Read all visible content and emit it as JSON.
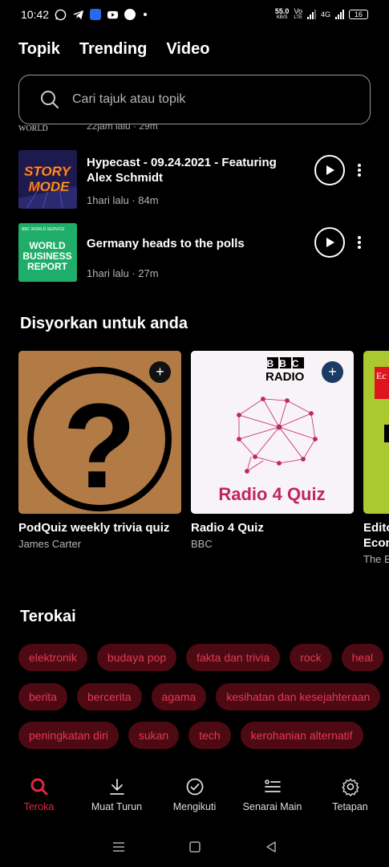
{
  "status": {
    "time": "10:42",
    "net_speed_value": "55.0",
    "net_speed_unit": "KB/S",
    "volte": "Vo",
    "lte": "LTE",
    "network": "4G",
    "battery": "16"
  },
  "tabs": [
    "Topik",
    "Trending",
    "Video"
  ],
  "search": {
    "placeholder": "Cari tajuk atau topik"
  },
  "partial_episode": {
    "brand": "WORLD",
    "meta": "22jam lalu · 29m"
  },
  "episodes": [
    {
      "title": "Hypecast - 09.24.2021 - Featuring Alex Schmidt",
      "meta": "1hari lalu · 84m",
      "art_text_1": "STORY",
      "art_text_2": "MODE"
    },
    {
      "title": "Germany heads to the polls",
      "meta": "1hari lalu · 27m",
      "art_brand": "BBC WORLD SERVICE",
      "art_text_1": "WORLD",
      "art_text_2": "BUSINESS",
      "art_text_3": "REPORT"
    }
  ],
  "recommended": {
    "title": "Disyorkan untuk anda",
    "cards": [
      {
        "title": "PodQuiz weekly trivia quiz",
        "author": "James Carter",
        "art_text": "?"
      },
      {
        "title": "Radio 4 Quiz",
        "author": "BBC",
        "art_brand_1": "BBC",
        "art_brand_2": "RADIO",
        "art_text": "Radio 4 Quiz"
      },
      {
        "title": "Edito",
        "title_line2": "Econ",
        "author": "The E",
        "art_text": "Ec"
      }
    ]
  },
  "explore": {
    "title": "Terokai",
    "rows": [
      [
        "elektronik",
        "budaya pop",
        "fakta dan trivia",
        "rock",
        "heal"
      ],
      [
        "berita",
        "bercerita",
        "agama",
        "kesihatan dan kesejahteraan"
      ],
      [
        "peningkatan diri",
        "sukan",
        "tech",
        "kerohanian alternatif"
      ]
    ]
  },
  "bottom_nav": [
    {
      "label": "Teroka",
      "icon": "search-icon",
      "active": true
    },
    {
      "label": "Muat Turun",
      "icon": "download-icon",
      "active": false
    },
    {
      "label": "Mengikuti",
      "icon": "check-circle-icon",
      "active": false
    },
    {
      "label": "Senarai Main",
      "icon": "playlist-icon",
      "active": false
    },
    {
      "label": "Tetapan",
      "icon": "gear-icon",
      "active": false
    }
  ],
  "colors": {
    "accent": "#e0263f",
    "chip_bg": "#4e0a13",
    "chip_text": "#e03a56"
  }
}
